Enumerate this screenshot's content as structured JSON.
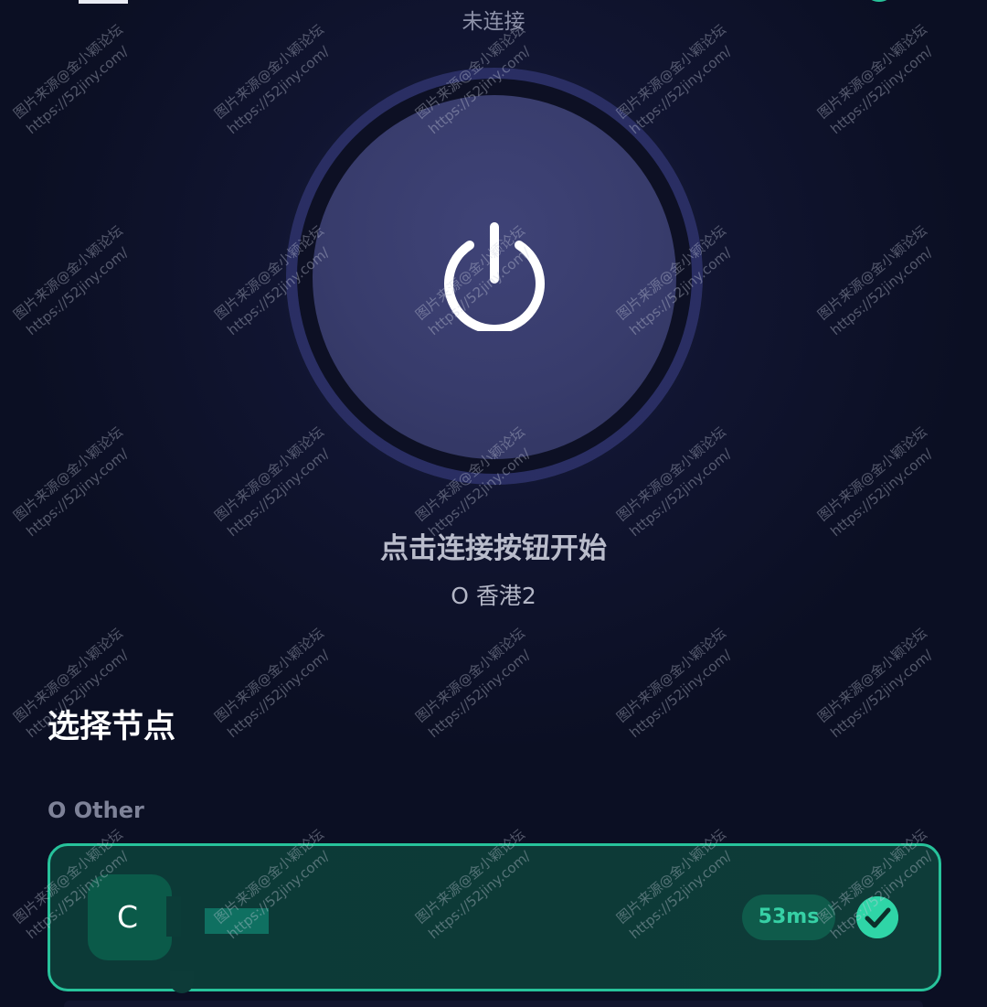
{
  "header": {
    "status": "未连接"
  },
  "main": {
    "hint": "点击连接按钮开始",
    "current_node": "O 香港2"
  },
  "node_list": {
    "title": "选择节点",
    "group": "O Other",
    "selected": {
      "badge": "C",
      "latency": "53ms"
    }
  },
  "watermark": {
    "line1": "图片来源@金小颖论坛",
    "line2": "https://52jiny.com/"
  },
  "colors": {
    "accent": "#27c39b",
    "background": "#0b0f23",
    "button": "#383c6c"
  }
}
